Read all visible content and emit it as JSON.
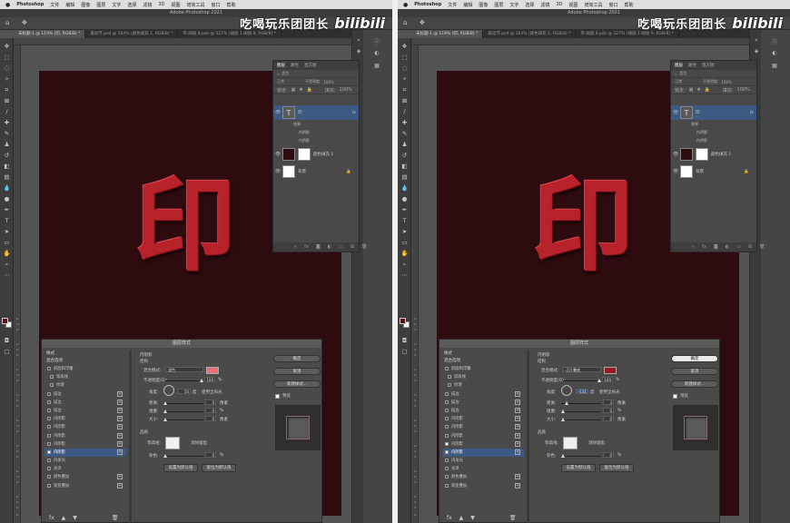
{
  "menubar": {
    "apple": "",
    "app": "Photoshop",
    "items": [
      "文件",
      "编辑",
      "图像",
      "图层",
      "文字",
      "选择",
      "滤镜",
      "3D",
      "视图",
      "增效工具",
      "窗口",
      "帮助"
    ]
  },
  "window_title": "Adobe Photoshop 2021",
  "watermark": {
    "text": "吃喝玩乐团团长",
    "logo": "bilibili"
  },
  "tabs": [
    "未标题-1 @ 119% (印, RGB/8) *",
    "邀动节.psd @ 164% (颜色填充 1, RGB/8) *",
    "带 阈值 8.psb @ 327% (阈值 1 阈值 9, RGB/8) *"
  ],
  "canvas_glyph": "印",
  "ruler_left": [
    "3",
    "5",
    "0",
    "1",
    "0",
    "0",
    "1",
    "5",
    "0",
    "2",
    "0",
    "0",
    "2",
    "5",
    "0",
    "3",
    "0",
    "0",
    "3",
    "5",
    "0",
    "4",
    "0",
    "0",
    "4",
    "5",
    "0"
  ],
  "layers_panel": {
    "tabs": [
      "图层",
      "路径",
      "直方图"
    ],
    "search_placeholder": "类型",
    "blend_left": {
      "mode": "正常",
      "opacity_label": "不透明度:",
      "opacity": "100%"
    },
    "blend_right": {
      "mode": "正常",
      "opacity_label": "不透明度:",
      "opacity": "100%"
    },
    "lock_label": "锁定:",
    "fill_label": "填充:",
    "fill": "100%",
    "layers": [
      {
        "name": "印",
        "type": "text",
        "fx": "fx"
      },
      {
        "name": "颜色填充 1",
        "type": "fill"
      },
      {
        "name": "背景",
        "type": "background"
      }
    ],
    "effects_label": "效果",
    "effects": [
      "内阴影",
      "内阴影"
    ]
  },
  "dialog": {
    "title": "图层样式",
    "styles_header": "样式",
    "blend_options": "混合选项",
    "items": [
      {
        "label": "斜面和浮雕",
        "checked": false,
        "indent": false
      },
      {
        "label": "等高线",
        "checked": false,
        "indent": true
      },
      {
        "label": "纹理",
        "checked": false,
        "indent": true
      },
      {
        "label": "描边",
        "checked": false,
        "plus": true
      },
      {
        "label": "描边",
        "checked": false,
        "plus": true
      },
      {
        "label": "描边",
        "checked": false,
        "plus": true
      },
      {
        "label": "内阴影",
        "checked": false,
        "plus": true
      },
      {
        "label": "内阴影",
        "checked": false,
        "plus": true
      },
      {
        "label": "内阴影",
        "checked": false,
        "plus": true
      },
      {
        "label": "内阴影",
        "checked": false,
        "plus": true
      },
      {
        "label": "内阴影",
        "checked": true,
        "plus": true
      },
      {
        "label": "内发光",
        "checked": false
      },
      {
        "label": "光泽",
        "checked": false
      },
      {
        "label": "颜色叠加",
        "checked": false,
        "plus": true
      },
      {
        "label": "渐变叠加",
        "checked": false,
        "plus": true
      }
    ],
    "fx_icon": "fx",
    "section_title": "内阴影",
    "structure": "结构",
    "blend_mode_label": "混合模式:",
    "opacity_label": "不透明度(O):",
    "angle_label": "角度:",
    "global_light": "使用全局光",
    "distance_label": "距离:",
    "choke_label": "阻塞:",
    "size_label": "大小:",
    "quality": "品质",
    "contour_label": "等高线:",
    "antialias": "消除锯齿",
    "noise_label": "杂色:",
    "px": "像素",
    "pct": "%",
    "deg": "度",
    "make_default": "设置为默认值",
    "reset_default": "复位为默认值",
    "ok": "确定",
    "cancel": "取消",
    "new_style": "新建样式...",
    "preview": "预览",
    "left": {
      "blend_mode": "滤色",
      "opacity": "100",
      "angle": "50",
      "distance": "0",
      "choke": "0",
      "size": "0",
      "noise": "0",
      "color": "#e8707a"
    },
    "right": {
      "blend_mode": "正片叠底",
      "opacity": "100",
      "angle": "-131",
      "distance": "3",
      "choke": "0",
      "size": "0",
      "noise": "0",
      "color": "#9a1820"
    }
  }
}
